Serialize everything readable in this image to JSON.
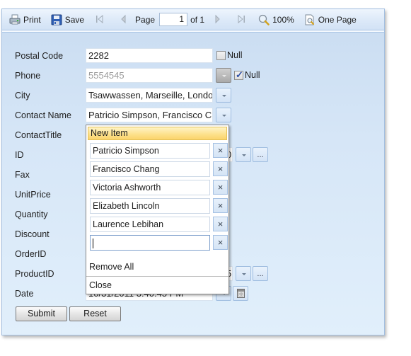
{
  "toolbar": {
    "print_label": "Print",
    "save_label": "Save",
    "first_icon": "first-page-icon",
    "prev_icon": "prev-page-icon",
    "page_label": "Page",
    "page_value": "1",
    "of_label": "of 1",
    "next_icon": "next-page-icon",
    "last_icon": "last-page-icon",
    "zoom_label": "100%",
    "one_page_label": "One Page"
  },
  "form": {
    "fields": [
      {
        "label": "Postal Code",
        "value": "2282",
        "null_label": "Null",
        "null_checked": false
      },
      {
        "label": "Phone",
        "value": "5554545",
        "placeholder_state": "disabled",
        "null_label": "Null",
        "null_checked": true
      },
      {
        "label": "City",
        "value": "Tsawwassen, Marseille, London"
      },
      {
        "label": "Contact Name",
        "value": "Patricio Simpson, Francisco Chang"
      },
      {
        "label": "ContactTitle"
      },
      {
        "label": "ID",
        "partial_value": "0"
      },
      {
        "label": "Fax"
      },
      {
        "label": "UnitPrice"
      },
      {
        "label": "Quantity"
      },
      {
        "label": "Discount"
      },
      {
        "label": "OrderID"
      },
      {
        "label": "ProductID",
        "partial_value": "5"
      },
      {
        "label": "Date",
        "value": "10/31/2011 3:40:45 PM"
      }
    ],
    "ellipsis_label": "...",
    "submit_label": "Submit",
    "reset_label": "Reset"
  },
  "popup": {
    "new_item_label": "New Item",
    "items": [
      "Patricio Simpson",
      "Francisco Chang",
      "Victoria Ashworth",
      "Elizabeth Lincoln",
      "Laurence Lebihan",
      ""
    ],
    "remove_glyph": "×",
    "remove_all_label": "Remove All",
    "close_label": "Close"
  },
  "colors": {
    "frame_border": "#a3bfe0",
    "highlight": "#fde08a"
  }
}
